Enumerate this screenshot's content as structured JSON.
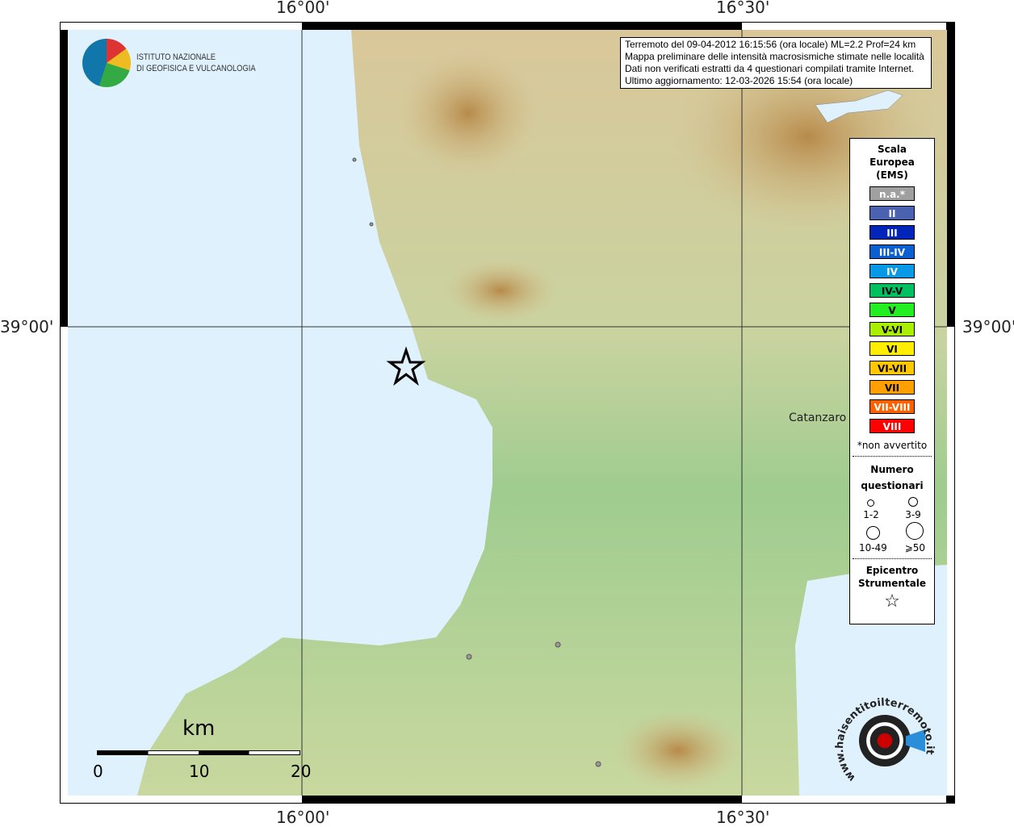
{
  "axes": {
    "top": [
      "16°00'",
      "16°30'"
    ],
    "bottom": [
      "16°00'",
      "16°30'"
    ],
    "left": "39°00'",
    "right": "39°00'"
  },
  "logo": {
    "line1": "ISTITUTO NAZIONALE",
    "line2": "DI GEOFISICA E VULCANOLOGIA"
  },
  "info": [
    "Terremoto del 09-04-2012 16:15:56 (ora locale) ML=2.2 Prof=24 km",
    "Mappa preliminare delle intensità macrosismiche stimate nelle località",
    "Dati non verificati estratti da 4 questionari compilati tramite Internet.",
    "Ultimo aggiornamento: 12-03-2026 15:54 (ora locale)"
  ],
  "place": "Catanzaro",
  "legend": {
    "title": [
      "Scala",
      "Europea",
      "(EMS)"
    ],
    "classes": [
      {
        "label": "n.a.*",
        "color": "#a0a0a0"
      },
      {
        "label": "II",
        "color": "#4b62b0"
      },
      {
        "label": "III",
        "color": "#0025b8"
      },
      {
        "label": "III-IV",
        "color": "#0b5fd0"
      },
      {
        "label": "IV",
        "color": "#0899e6"
      },
      {
        "label": "IV-V",
        "color": "#00c060"
      },
      {
        "label": "V",
        "color": "#22ee22"
      },
      {
        "label": "V-VI",
        "color": "#aaee00"
      },
      {
        "label": "VI",
        "color": "#ffee00"
      },
      {
        "label": "VI-VII",
        "color": "#ffc800"
      },
      {
        "label": "VII",
        "color": "#ffa000"
      },
      {
        "label": "VII-VIII",
        "color": "#ff6000"
      },
      {
        "label": "VIII",
        "color": "#ff0000"
      }
    ],
    "note": "*non avvertito",
    "count_title": [
      "Numero",
      "questionari"
    ],
    "counts": [
      "1-2",
      "3-9",
      "10-49",
      "⩾50"
    ],
    "epi_title": [
      "Epicentro",
      "Strumentale"
    ]
  },
  "scale": {
    "unit": "km",
    "labels": [
      "0",
      "10",
      "20"
    ]
  },
  "brand": "www.haisentitoilterremoto.it"
}
